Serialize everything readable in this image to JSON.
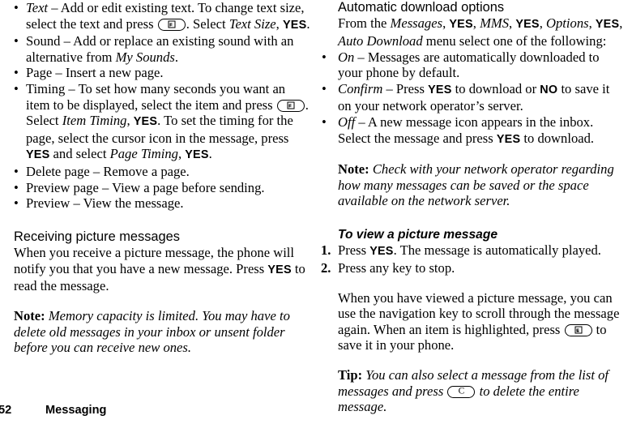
{
  "document": {
    "footer": {
      "page_number": "52",
      "section": "Messaging"
    }
  },
  "left_column": {
    "options_list": [
      {
        "bullet": "•",
        "term": "Text",
        "line1_a": "Text",
        "line1_b": " – Add or edit existing text. To change text size,",
        "line2_a": "select the text and press ",
        "key_icon": "menu-key-icon",
        "line2_b": ". Select ",
        "line2_italic": "Text Size",
        "line2_c": ", ",
        "line2_key": "YES",
        "line2_d": "."
      },
      {
        "bullet": "•",
        "term": "Sound",
        "text_a": "Sound – Add or replace an existing sound with an alternative from ",
        "text_italic": "My Sounds",
        "text_b": "."
      },
      {
        "bullet": "•",
        "term": "Page",
        "text": "Page – Insert a new page."
      },
      {
        "bullet": "•",
        "term": "Timing",
        "text_a": "Timing – To set how many seconds you want an item to be displayed, select the item and press ",
        "key_icon_1": "menu-key-icon",
        "text_b": ". Select ",
        "italic_1": "Item Timing",
        "text_c": ", ",
        "key_1": "YES",
        "text_d": ". To set the timing for the page, select the cursor icon in the message, press ",
        "key_2": "YES",
        "text_e": " and select ",
        "italic_2": "Page Timing",
        "text_f": ", ",
        "key_3": "YES",
        "text_g": "."
      },
      {
        "bullet": "•",
        "term": "Delete page",
        "text": "Delete page – Remove a page."
      },
      {
        "bullet": "•",
        "term": "Preview page",
        "text": "Preview page – View a page before sending."
      },
      {
        "bullet": "•",
        "term": "Preview",
        "text": "Preview – View the message."
      }
    ],
    "receiving_section": {
      "heading": "Receiving picture messages",
      "body_a": "When you receive a picture message, the phone will notify you that you have a new message. Press ",
      "body_key": "YES",
      "body_b": " to read the message."
    },
    "note": {
      "label": "Note:",
      "text": " Memory capacity is limited. You may have to delete old messages in your inbox or unsent folder before you can receive new ones."
    }
  },
  "right_column": {
    "auto_download_section": {
      "heading": "Automatic download options",
      "intro_a": "From the ",
      "intro_italic_1": "Messages",
      "intro_sep_1": ", ",
      "intro_key_1": "YES",
      "intro_sep_2": ", ",
      "intro_italic_2": "MMS",
      "intro_sep_3": ", ",
      "intro_key_2": "YES",
      "intro_sep_4": ", ",
      "intro_italic_3": "Options",
      "intro_sep_5": ", ",
      "intro_key_3": "YES",
      "intro_sep_6": ", ",
      "intro_italic_4": "Auto Download",
      "intro_b": " menu select one of the following:",
      "items": [
        {
          "bullet": "•",
          "term": "On",
          "text": " – Messages are automatically downloaded to your phone by default."
        },
        {
          "bullet": "•",
          "term": "Confirm",
          "text_a": " – Press ",
          "key_1": "YES",
          "text_b": " to download or ",
          "key_2": "NO",
          "text_c": " to save it on your network operator’s server."
        },
        {
          "bullet": "•",
          "term": "Off",
          "text_a": " – A new message icon appears in the inbox. Select the message and press ",
          "key_1": "YES",
          "text_b": " to download."
        }
      ]
    },
    "note": {
      "label": "Note:",
      "text": " Check with your network operator regarding how many messages can be saved or the space available on the network server."
    },
    "view_section": {
      "heading": "To view a picture message",
      "steps": [
        {
          "number": "1.",
          "text_a": "Press ",
          "key": "YES",
          "text_b": ". The message is automatically played."
        },
        {
          "number": "2.",
          "text_a": "Press any key to stop.",
          "key": "",
          "text_b": ""
        }
      ],
      "body_a": "When you have viewed a picture message, you can use the navigation key to scroll through the message again. When an item is highlighted, press ",
      "body_key_icon": "menu-key-icon",
      "body_b": " to save it in your phone."
    },
    "tip": {
      "label": "Tip:",
      "text_a": " You can also select a message from the list of messages and press ",
      "key_icon": "clear-key-icon",
      "key_icon_label": "C",
      "text_b": " to delete the entire message."
    }
  }
}
